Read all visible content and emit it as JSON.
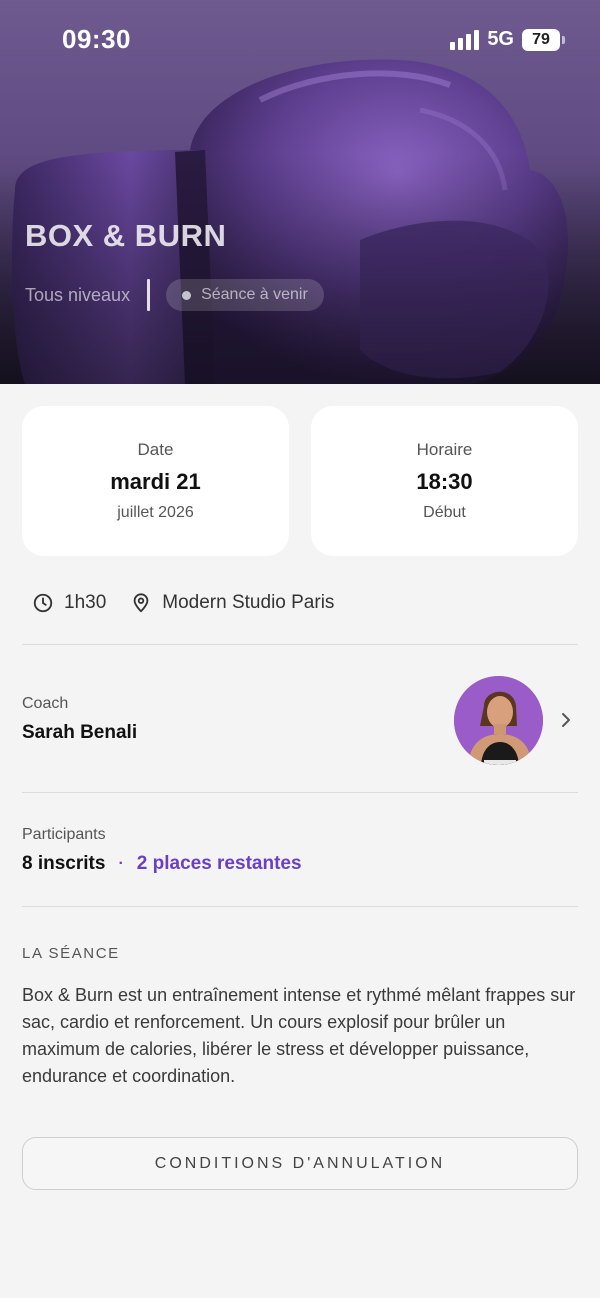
{
  "status_bar": {
    "time": "09:30",
    "network": "5G",
    "battery": "79"
  },
  "hero": {
    "title": "BOX & BURN",
    "level": "Tous niveaux",
    "status_chip": "Séance à venir"
  },
  "cards": {
    "date": {
      "label": "Date",
      "value": "mardi 21",
      "sub": "juillet 2026"
    },
    "time": {
      "label": "Horaire",
      "value": "18:30",
      "sub": "Début"
    }
  },
  "details": {
    "duration": "1h30",
    "location": "Modern Studio Paris"
  },
  "coach": {
    "label": "Coach",
    "name": "Sarah Benali"
  },
  "participants": {
    "label": "Participants",
    "count": "8 inscrits",
    "separator": "·",
    "remaining": "2 places restantes"
  },
  "session": {
    "title": "LA SÉANCE",
    "description": "Box & Burn est un entraînement intense et rythmé mêlant frappes sur sac, cardio et renforcement. Un cours explosif pour brûler un maximum de calories, libérer le stress et développer puissance, endurance et coordination."
  },
  "cancellation_button": "CONDITIONS D'ANNULATION",
  "colors": {
    "accent": "#6a3fc4",
    "hero_purple": "#5e4a80",
    "glove": "#5b3d8c"
  }
}
